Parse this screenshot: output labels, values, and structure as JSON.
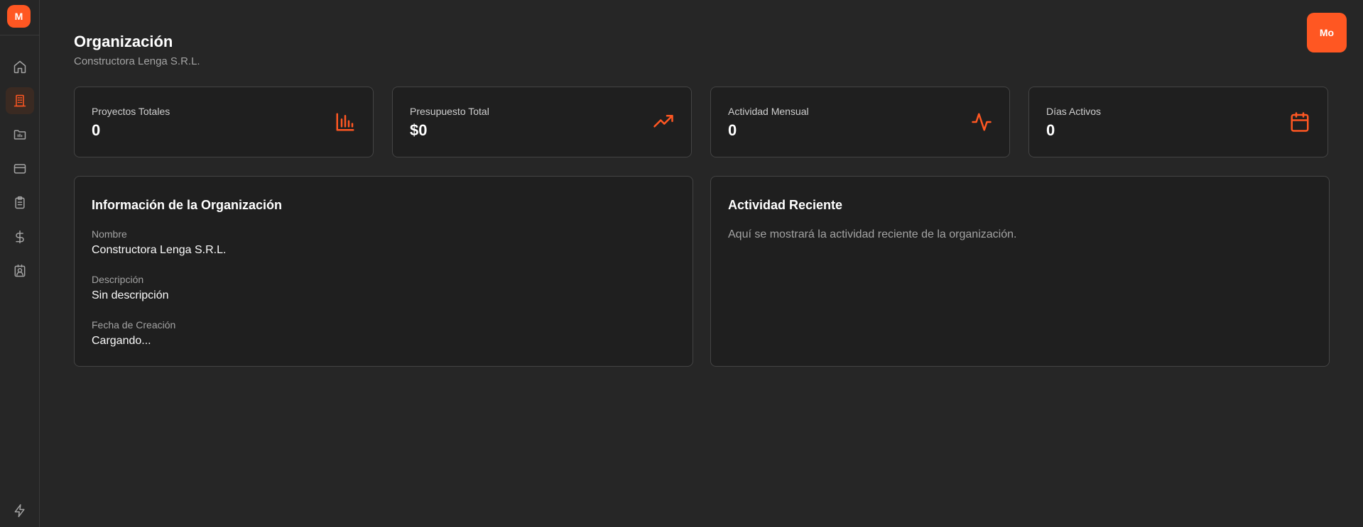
{
  "sidebar": {
    "logo_text": "M",
    "items": [
      {
        "icon": "home-icon",
        "active": false
      },
      {
        "icon": "building-icon",
        "active": true
      },
      {
        "icon": "folder-icon",
        "active": false
      },
      {
        "icon": "credit-card-icon",
        "active": false
      },
      {
        "icon": "clipboard-icon",
        "active": false
      },
      {
        "icon": "dollar-icon",
        "active": false
      },
      {
        "icon": "contact-icon",
        "active": false
      }
    ],
    "bottom_icon": "zap-icon"
  },
  "header": {
    "title": "Organización",
    "subtitle": "Constructora Lenga S.R.L.",
    "user_initials": "Mo"
  },
  "stats": [
    {
      "label": "Proyectos Totales",
      "value": "0",
      "icon": "bar-chart-icon"
    },
    {
      "label": "Presupuesto Total",
      "value": "$0",
      "icon": "trending-up-icon"
    },
    {
      "label": "Actividad Mensual",
      "value": "0",
      "icon": "activity-icon"
    },
    {
      "label": "Días Activos",
      "value": "0",
      "icon": "calendar-icon"
    }
  ],
  "org_info": {
    "title": "Información de la Organización",
    "fields": [
      {
        "label": "Nombre",
        "value": "Constructora Lenga S.R.L."
      },
      {
        "label": "Descripción",
        "value": "Sin descripción"
      },
      {
        "label": "Fecha de Creación",
        "value": "Cargando..."
      }
    ]
  },
  "recent_activity": {
    "title": "Actividad Reciente",
    "text": "Aquí se mostrará la actividad reciente de la organización."
  },
  "colors": {
    "accent": "#ff5722",
    "background": "#262626",
    "card": "#1f1f1f"
  }
}
